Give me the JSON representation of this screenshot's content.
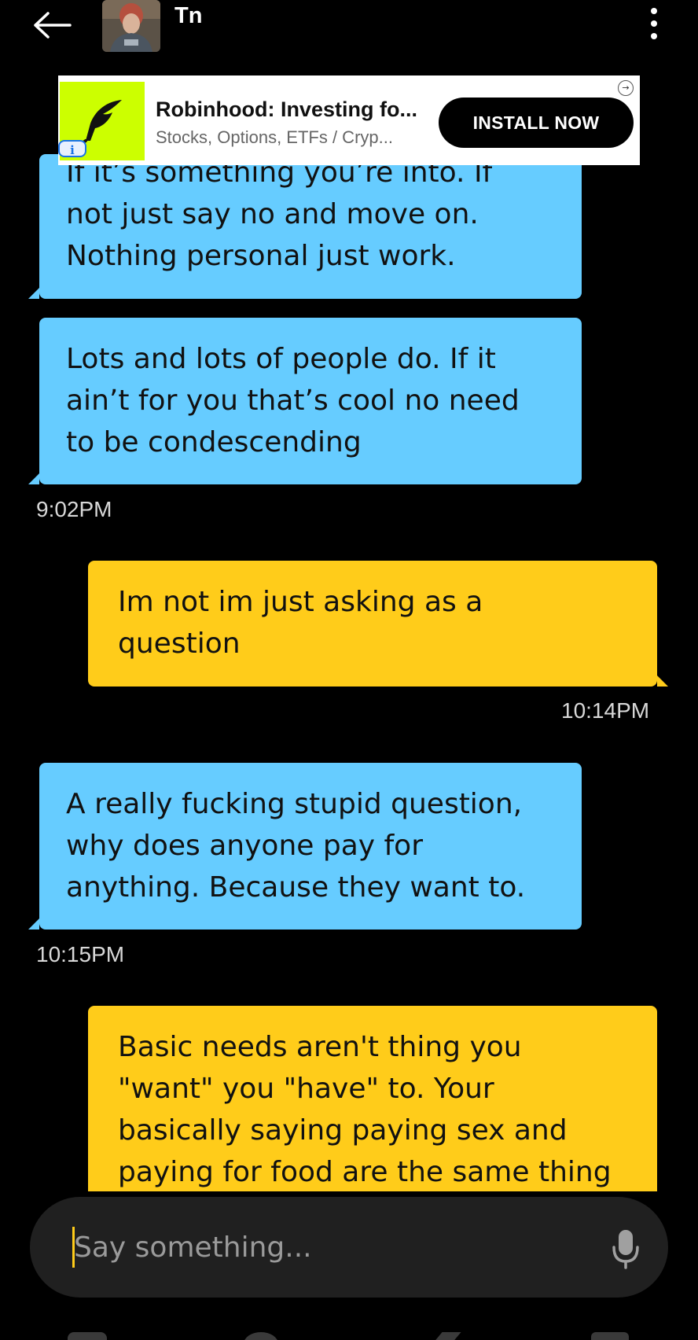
{
  "header": {
    "contact_name": "Tn",
    "back_icon": "arrow-left-icon",
    "menu_icon": "more-vertical-icon"
  },
  "ad": {
    "title": "Robinhood: Investing fo...",
    "subtitle": "Stocks, Options, ETFs / Cryp...",
    "install_label": "INSTALL NOW",
    "info_glyph": "i",
    "adchoices_glyph": "→",
    "brand_color": "#ccff00"
  },
  "messages": [
    {
      "direction": "in",
      "lines": [
        "If it’s something you’re into. If",
        "not just say no and move on.",
        "Nothing personal just work."
      ]
    },
    {
      "direction": "in",
      "lines": [
        "Lots and lots of people do. If it",
        "ain’t for you that’s cool no need",
        "to be condescending"
      ]
    },
    {
      "direction": "out",
      "lines": [
        "Im not im just asking as a",
        "question"
      ]
    },
    {
      "direction": "in",
      "lines": [
        "A really fucking stupid question,",
        "why does anyone pay for",
        "anything. Because they want to."
      ]
    },
    {
      "direction": "out",
      "lines": [
        "Basic needs aren't thing you",
        "\"want\" you \"have\" to. Your",
        "basically saying paying sex and",
        "paying for food are the same thing"
      ]
    }
  ],
  "timestamps": [
    "9:02PM",
    "10:14PM",
    "10:15PM"
  ],
  "input": {
    "placeholder": "Say something...",
    "value": "",
    "mic_icon": "microphone-icon"
  },
  "colors": {
    "incoming_bubble": "#66ccff",
    "outgoing_bubble": "#ffcc1a",
    "background": "#000000",
    "input_bar": "#202020"
  }
}
